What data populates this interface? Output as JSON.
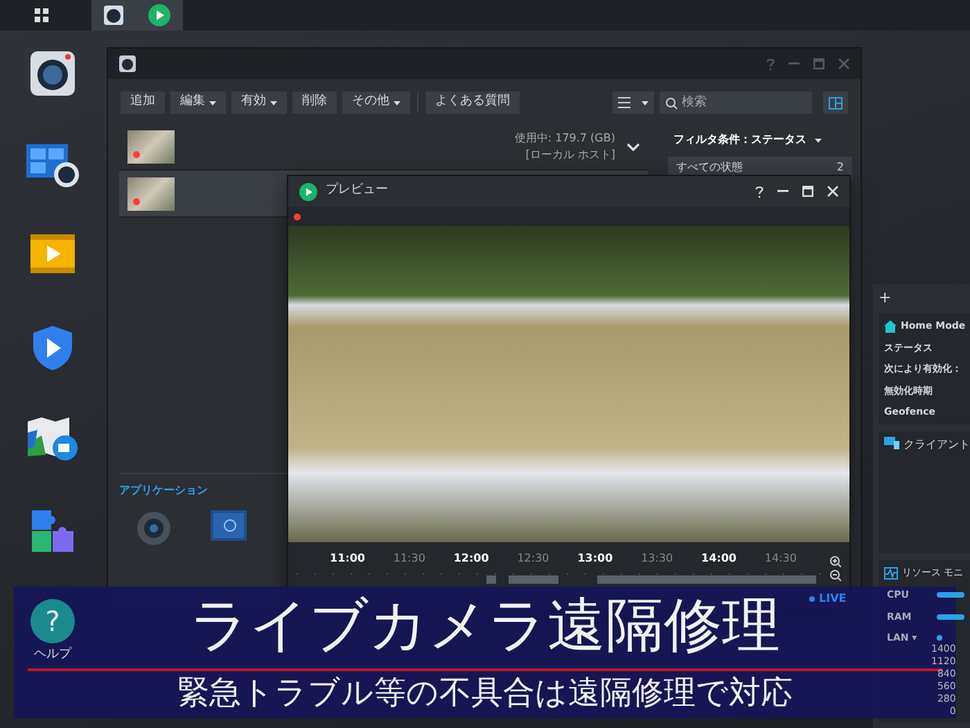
{
  "desktop_icons": [
    {
      "kind": "camera"
    },
    {
      "kind": "monitor"
    },
    {
      "kind": "film"
    },
    {
      "kind": "shield"
    },
    {
      "kind": "map"
    },
    {
      "kind": "puzzle"
    },
    {
      "kind": "help",
      "glyph": "?",
      "label": "ヘルプ"
    }
  ],
  "main_window": {
    "toolbar": [
      {
        "label": "追加",
        "dropdown": false
      },
      {
        "label": "編集",
        "dropdown": true
      },
      {
        "label": "有効",
        "dropdown": true
      },
      {
        "label": "削除",
        "dropdown": false
      },
      {
        "label": "その他",
        "dropdown": true
      },
      {
        "label": "よくある質問",
        "dropdown": false
      }
    ],
    "search": {
      "placeholder": "検索"
    },
    "cameras": [
      {
        "selected": false,
        "recording": true
      },
      {
        "selected": true,
        "recording": true
      }
    ],
    "storage": {
      "usage": "使用中: 179.7 (GB)",
      "host": "[ローカル ホスト]"
    },
    "filter": {
      "title": "フィルタ条件：ステータス",
      "items": [
        {
          "label": "すべての状態",
          "count": "2",
          "selected": true
        }
      ]
    },
    "applications": {
      "title": "アプリケーション"
    }
  },
  "preview": {
    "title": "プレビュー",
    "timeline": {
      "ticks": [
        {
          "label": "11:00",
          "major": true
        },
        {
          "label": "11:30",
          "major": false
        },
        {
          "label": "12:00",
          "major": true
        },
        {
          "label": "12:30",
          "major": false
        },
        {
          "label": "13:00",
          "major": true
        },
        {
          "label": "13:30",
          "major": false
        },
        {
          "label": "14:00",
          "major": true
        },
        {
          "label": "14:30",
          "major": false
        }
      ]
    },
    "live": "LIVE"
  },
  "widgets": {
    "add": "+",
    "home_mode": {
      "title": "Home Mode",
      "rows": [
        "ステータス",
        "次により有効化：",
        "無効化時期",
        "Geofence"
      ]
    },
    "client": {
      "title": "クライアント"
    },
    "resource": {
      "title": "リソース モニ",
      "rows": [
        {
          "label": "CPU",
          "kind": "bar"
        },
        {
          "label": "RAM",
          "kind": "bar"
        },
        {
          "label": "LAN ▾",
          "kind": "dot"
        }
      ],
      "yticks": [
        "1400",
        "1120",
        "840",
        "560",
        "280",
        "0"
      ]
    }
  },
  "banner": {
    "title": "ライブカメラ遠隔修理",
    "subtitle": "緊急トラブル等の不具合は遠隔修理で対応"
  }
}
